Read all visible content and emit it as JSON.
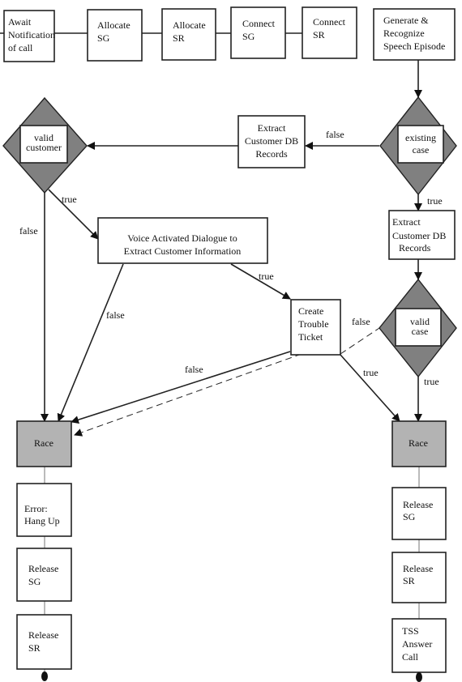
{
  "colors": {
    "decision_fill": "#808080",
    "race_fill": "#b3b3b3",
    "box_fill": "#ffffff",
    "line": "#222222"
  },
  "nodes": {
    "await": [
      "Await",
      "Notification",
      "of call"
    ],
    "allocate_sg": [
      "Allocate",
      "SG"
    ],
    "allocate_sr": [
      "Allocate",
      "SR"
    ],
    "connect_sg": [
      "Connect",
      "SG"
    ],
    "connect_sr": [
      "Connect",
      "SR"
    ],
    "generate": [
      "Generate &",
      "Recognize",
      "Speech Episode"
    ],
    "existing_case": [
      "existing",
      "case"
    ],
    "extract_db_1": [
      "Extract",
      "Customer DB",
      "Records"
    ],
    "valid_customer": [
      "valid",
      "customer"
    ],
    "voice_dialogue": [
      "Voice Activated Dialogue to",
      "Extract Customer Information"
    ],
    "extract_db_2": [
      "Extract",
      "Customer DB",
      "Records"
    ],
    "valid_case": [
      "valid",
      "case"
    ],
    "trouble_ticket": [
      "Create",
      "Trouble",
      "Ticket"
    ],
    "race_left": "Race",
    "race_right": "Race",
    "error": [
      "Error:",
      "Hang Up"
    ],
    "release_sg_left": [
      "Release",
      "SG"
    ],
    "release_sr_left": [
      "Release",
      "SR"
    ],
    "release_sg_right": [
      "Release",
      "SG"
    ],
    "release_sr_right": [
      "Release",
      "SR"
    ],
    "tss_answer": [
      "TSS",
      "Answer",
      "Call"
    ]
  },
  "edge_labels": {
    "existing_false": "false",
    "existing_true": "true",
    "valid_customer_true": "true",
    "valid_customer_false": "false",
    "voice_false": "false",
    "voice_true": "true",
    "ticket_false": "false",
    "ticket_true": "true",
    "valid_case_false": "false",
    "valid_case_true": "true"
  }
}
